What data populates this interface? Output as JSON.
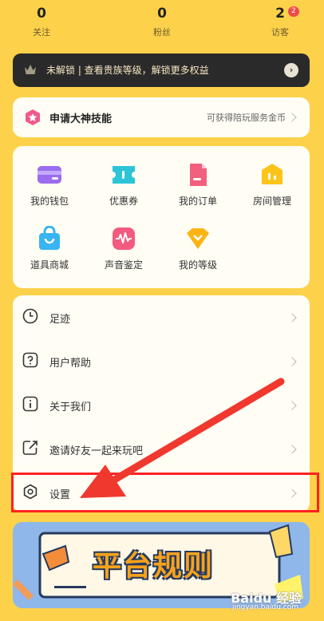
{
  "stats": [
    {
      "value": "0",
      "label": "关注"
    },
    {
      "value": "0",
      "label": "粉丝"
    },
    {
      "value": "2",
      "label": "访客",
      "badge": "2"
    }
  ],
  "vip_bar": {
    "text": "未解锁 | 查看贵族等级，解锁更多权益",
    "icon": "crown-icon"
  },
  "apply_card": {
    "title": "申请大神技能",
    "hint": "可获得陪玩服务金币"
  },
  "features": [
    {
      "label": "我的钱包",
      "icon": "wallet-icon"
    },
    {
      "label": "优惠券",
      "icon": "coupon-icon"
    },
    {
      "label": "我的订单",
      "icon": "order-icon"
    },
    {
      "label": "房间管理",
      "icon": "room-manage-icon"
    },
    {
      "label": "道具商城",
      "icon": "shopping-bag-icon"
    },
    {
      "label": "声音鉴定",
      "icon": "voice-wave-icon"
    },
    {
      "label": "我的等级",
      "icon": "level-icon"
    }
  ],
  "menu": [
    {
      "label": "足迹",
      "icon": "clock-icon"
    },
    {
      "label": "用户帮助",
      "icon": "help-icon"
    },
    {
      "label": "关于我们",
      "icon": "info-icon"
    },
    {
      "label": "邀请好友一起来玩吧",
      "icon": "share-icon"
    },
    {
      "label": "设置",
      "icon": "settings-icon"
    }
  ],
  "banner": {
    "title": "平台规则"
  },
  "watermark": {
    "brand": "Baidu 经验",
    "url": "jingyan.baidu.com"
  },
  "colors": {
    "background": "#fdd24a",
    "card": "#fffdf4",
    "highlight": "#ff2121",
    "vip_bar": "#2b2a2a"
  }
}
